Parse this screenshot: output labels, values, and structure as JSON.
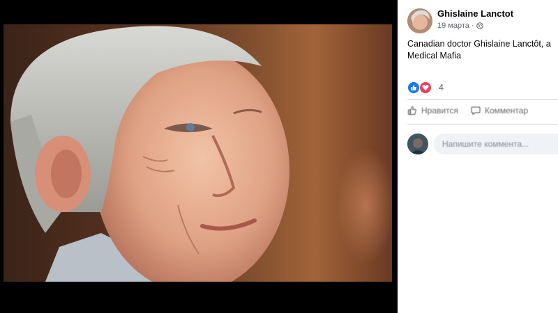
{
  "post": {
    "author_name": "Ghislaine Lanctot",
    "date": "19 марта",
    "visibility_icon": "globe-icon",
    "caption_line1": "Canadian doctor Ghislaine Lanctôt, a",
    "caption_line2": "Medical Mafia"
  },
  "reactions": {
    "icons": [
      "like-icon",
      "love-icon"
    ],
    "count": "4"
  },
  "actions": {
    "like_label": "Нравится",
    "comment_label": "Комментар"
  },
  "comment_box": {
    "placeholder": "Напишите коммента..."
  },
  "colors": {
    "like_blue": "#1877f2",
    "love_red": "#f33e58",
    "meta_gray": "#65676b"
  }
}
